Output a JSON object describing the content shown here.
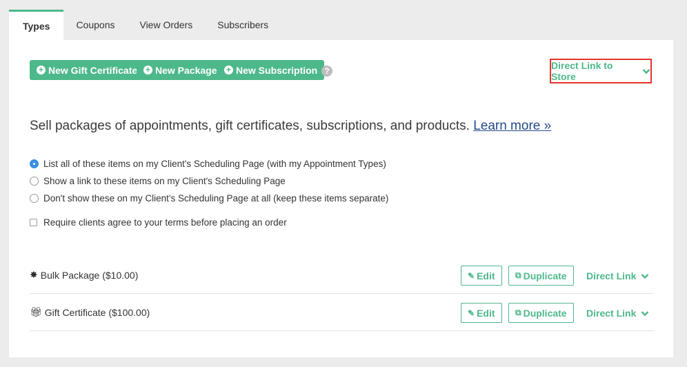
{
  "tabs": [
    {
      "label": "Types",
      "active": true
    },
    {
      "label": "Coupons"
    },
    {
      "label": "View Orders"
    },
    {
      "label": "Subscribers"
    }
  ],
  "actions": {
    "new_gift": "New Gift Certificate",
    "new_package": "New Package",
    "new_subscription": "New Subscription",
    "help": "?",
    "direct_store": "Direct Link to Store"
  },
  "intro": {
    "text": "Sell packages of appointments, gift certificates, subscriptions, and products.",
    "learn_more": "Learn more »"
  },
  "options": [
    {
      "label": "List all of these items on my Client's Scheduling Page (with my Appointment Types)",
      "checked": true
    },
    {
      "label": "Show a link to these items on my Client's Scheduling Page",
      "checked": false
    },
    {
      "label": "Don't show these on my Client's Scheduling Page at all (keep these items separate)",
      "checked": false
    }
  ],
  "terms_checkbox": {
    "label": "Require clients agree to your terms before placing an order",
    "checked": false
  },
  "items": [
    {
      "name": "Bulk Package ($10.00)",
      "icon": "badge-icon",
      "edit": "Edit",
      "duplicate": "Duplicate",
      "link": "Direct Link"
    },
    {
      "name": "Gift Certificate ($100.00)",
      "icon": "gift-icon",
      "edit": "Edit",
      "duplicate": "Duplicate",
      "link": "Direct Link"
    }
  ],
  "colors": {
    "accent": "#4db88a",
    "highlight": "#e5332a",
    "link": "#234a8a"
  }
}
